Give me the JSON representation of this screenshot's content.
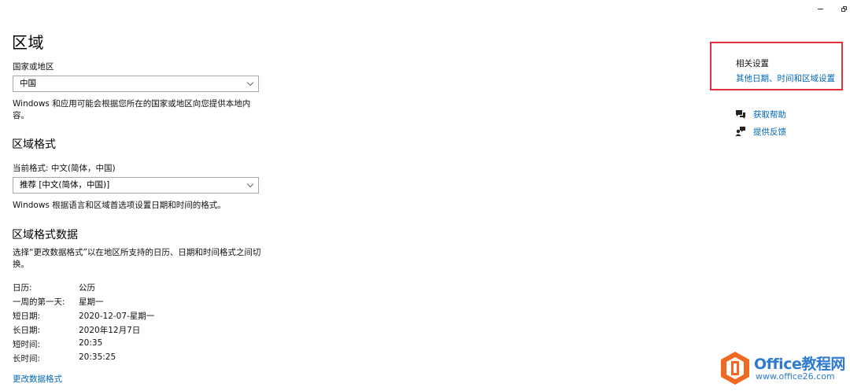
{
  "window": {
    "minimize_glyph": "–",
    "restore_glyph": "❐"
  },
  "page": {
    "title": "区域"
  },
  "country": {
    "label": "国家或地区",
    "selected": "中国",
    "description": "Windows 和应用可能会根据您所在的国家或地区向您提供本地内容。"
  },
  "format": {
    "heading": "区域格式",
    "current_label": "当前格式: 中文(简体，中国)",
    "selected": "推荐 [中文(简体，中国)]",
    "description": "Windows 根据语言和区域首选项设置日期和时间的格式。"
  },
  "format_data": {
    "heading": "区域格式数据",
    "description": "选择“更改数据格式”以在地区所支持的日历、日期和时间格式之间切换。",
    "rows": [
      {
        "key": "日历:",
        "value": "公历"
      },
      {
        "key": "一周的第一天:",
        "value": "星期一"
      },
      {
        "key": "短日期:",
        "value": "2020-12-07-星期一"
      },
      {
        "key": "长日期:",
        "value": "2020年12月7日"
      },
      {
        "key": "短时间:",
        "value": "20:35"
      },
      {
        "key": "长时间:",
        "value": "20:35:25"
      }
    ],
    "change_link": "更改数据格式"
  },
  "related": {
    "title": "相关设置",
    "link": "其他日期、时间和区域设置"
  },
  "side_links": {
    "help": "获取帮助",
    "feedback": "提供反馈"
  },
  "watermark": {
    "brand": "Office教程网",
    "site": "www.office26.com"
  },
  "colors": {
    "link": "#0067b8",
    "highlight_box": "#e0313c",
    "watermark_blue": "#2e7bd1",
    "watermark_orange": "#f06a22"
  }
}
